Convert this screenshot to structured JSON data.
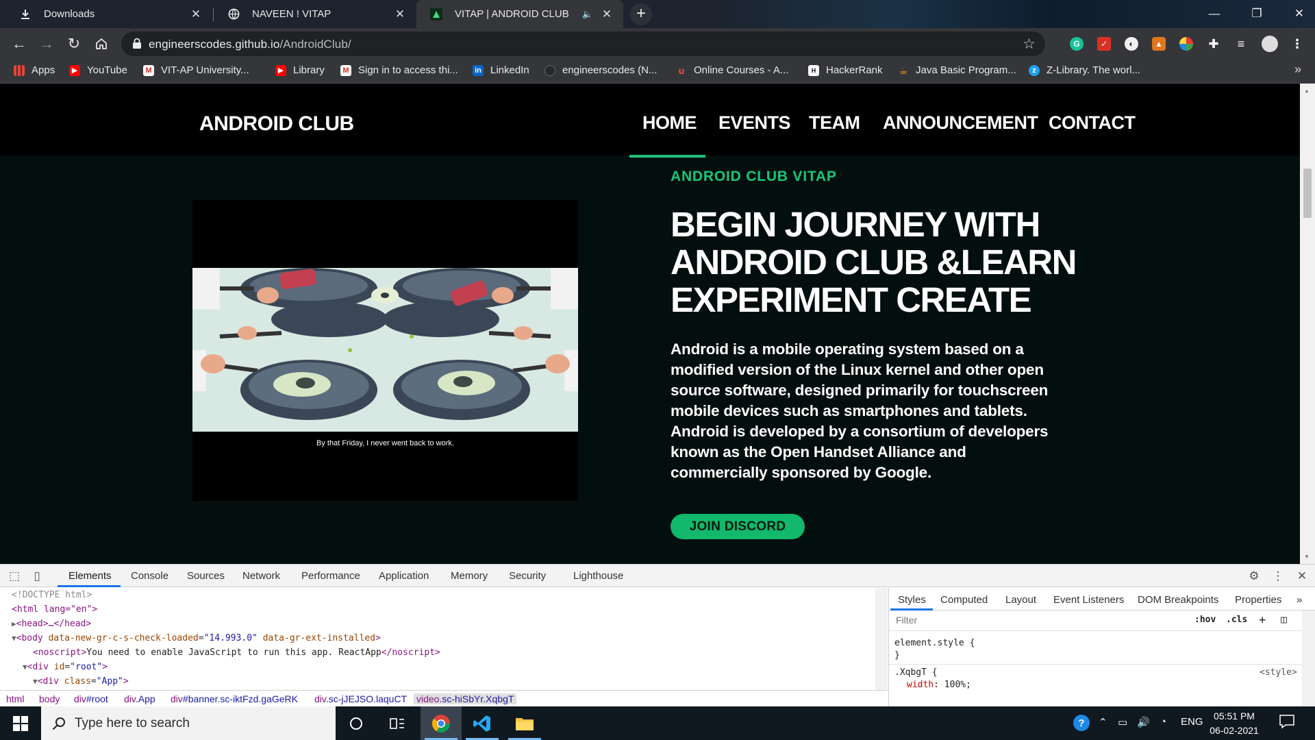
{
  "browser": {
    "tabs": [
      {
        "title": "Downloads",
        "icon": "download-icon"
      },
      {
        "title": "NAVEEN ! VITAP",
        "icon": "globe-icon"
      },
      {
        "title": "VITAP | ANDROID CLUB",
        "icon": "android-club-favicon"
      }
    ],
    "url_host": "engineerscodes.github.io",
    "url_path": "/AndroidClub/",
    "bookmarks": [
      {
        "label": "Apps",
        "icon": "apps-grid-icon"
      },
      {
        "label": "YouTube",
        "icon": "youtube-icon"
      },
      {
        "label": "VIT-AP University...",
        "icon": "gmail-icon"
      },
      {
        "label": "Library",
        "icon": "youtube-icon"
      },
      {
        "label": "Sign in to access thi...",
        "icon": "gmail-icon"
      },
      {
        "label": "LinkedIn",
        "icon": "linkedin-icon"
      },
      {
        "label": "engineerscodes (N...",
        "icon": "github-icon"
      },
      {
        "label": "Online Courses - A...",
        "icon": "udemy-icon"
      },
      {
        "label": "HackerRank",
        "icon": "hackerrank-icon"
      },
      {
        "label": "Java Basic Program...",
        "icon": "java-icon"
      },
      {
        "label": "Z-Library. The worl...",
        "icon": "zlibrary-icon"
      }
    ]
  },
  "site": {
    "brand": "ANDROID CLUB",
    "nav": [
      "HOME",
      "EVENTS",
      "TEAM",
      "ANNOUNCEMENT",
      "CONTACT"
    ],
    "active_nav": "HOME",
    "video_caption": "By that Friday, I never went back to work.",
    "kicker": "ANDROID CLUB VITAP",
    "headline": "BEGIN JOURNEY WITH ANDROID CLUB &LEARN EXPERIMENT CREATE",
    "body": "Android is a mobile operating system based on a modified version of the Linux kernel and other open source software, designed primarily for touchscreen mobile devices such as smartphones and tablets. Android is developed by a consortium of developers known as the Open Handset Alliance and commercially sponsored by Google.",
    "cta": "JOIN DISCORD",
    "colors": {
      "accent": "#18c67a",
      "button": "#12b86b",
      "background": "#030f0e"
    }
  },
  "devtools": {
    "tabs": [
      "Elements",
      "Console",
      "Sources",
      "Network",
      "Performance",
      "Application",
      "Memory",
      "Security",
      "Lighthouse"
    ],
    "active_tab": "Elements",
    "dom": {
      "doctype": "<!DOCTYPE html>",
      "html_open": "<html lang=\"en\">",
      "head": "<head>…</head>",
      "body_tag": "body",
      "body_attr1": "data-new-gr-c-s-check-loaded",
      "body_attr1_val": "\"14.993.0\"",
      "body_attr2": "data-gr-ext-installed",
      "noscript_open": "<noscript>",
      "noscript_text": "You need to enable JavaScript to run this app. ReactApp",
      "noscript_close": "</noscript>",
      "root_div": "div",
      "root_attr": "id",
      "root_val": "\"root\"",
      "app_div": "div",
      "app_attr": "class",
      "app_val": "\"App\""
    },
    "breadcrumbs": [
      {
        "tag": "html",
        "cls": ""
      },
      {
        "tag": "body",
        "cls": ""
      },
      {
        "tag": "div",
        "cls": "#root"
      },
      {
        "tag": "div",
        "cls": ".App"
      },
      {
        "tag": "div",
        "cls": "#banner.sc-iktFzd.gaGeRK"
      },
      {
        "tag": "div",
        "cls": ".sc-jJEJSO.laquCT"
      },
      {
        "tag": "video",
        "cls": ".sc-hiSbYr.XqbgT"
      }
    ],
    "styles_tabs": [
      "Styles",
      "Computed",
      "Layout",
      "Event Listeners",
      "DOM Breakpoints",
      "Properties"
    ],
    "filter_placeholder": "Filter",
    "hov": ":hov",
    "cls_toggle": ".cls",
    "element_style": "element.style {",
    "close_brace": "}",
    "rule_selector": ".XqbgT {",
    "rule_source": "<style>",
    "rule_prop": "width",
    "rule_val": "100%;"
  },
  "taskbar": {
    "search_placeholder": "Type here to search",
    "language": "ENG",
    "time": "05:51 PM",
    "date": "06-02-2021"
  }
}
